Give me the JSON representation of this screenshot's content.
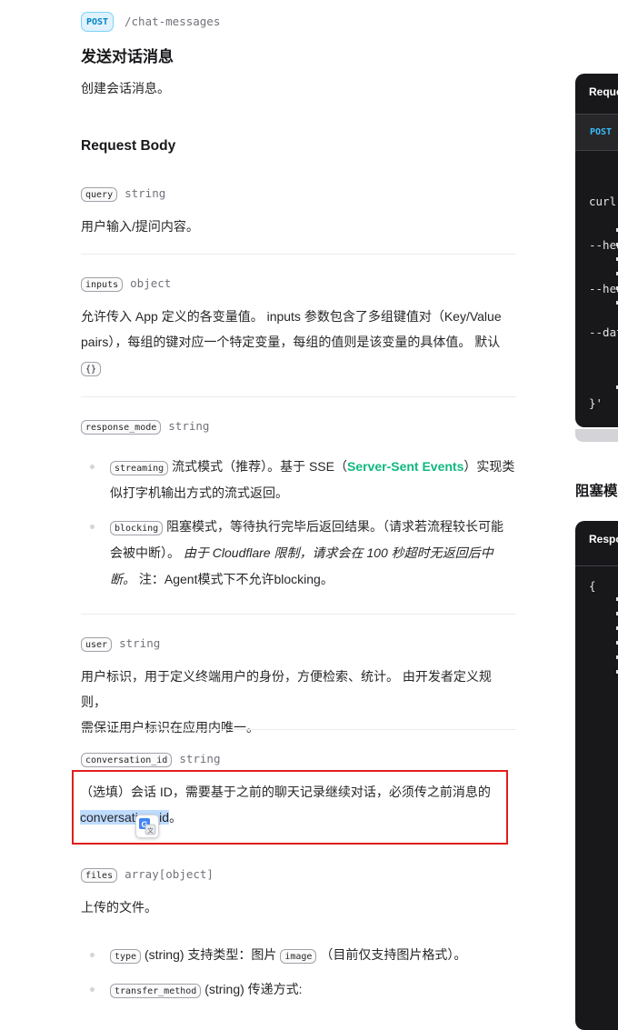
{
  "endpoint": {
    "method": "POST",
    "path": "/chat-messages",
    "title": "发送对话消息",
    "description": "创建会话消息。"
  },
  "request_body_heading": "Request Body",
  "params": {
    "query": {
      "name": "query",
      "type": "string",
      "desc": "用户输入/提问内容。"
    },
    "inputs": {
      "name": "inputs",
      "type": "object",
      "desc_line1": "允许传入 App 定义的各变量值。 inputs 参数包含了多组键值对（Key/Value",
      "desc_line2": "pairs），每组的键对应一个特定变量，每组的值则是该变量的具体值。 默认",
      "default_chip": "{}"
    },
    "response_mode": {
      "name": "response_mode",
      "type": "string",
      "streaming_chip": "streaming",
      "streaming_text_a": "流式模式（推荐）。基于 SSE（",
      "streaming_link": "Server-Sent Events",
      "streaming_text_b": "）实现类",
      "streaming_text_c": "似打字机输出方式的流式返回。",
      "blocking_chip": "blocking",
      "blocking_text_a": "阻塞模式，等待执行完毕后返回结果。（请求若流程较长可能",
      "blocking_text_b": "会被中断）。",
      "blocking_italic_a": "由于 Cloudflare 限制，请求会在 100 秒超时无返回后中",
      "blocking_italic_b": "断。",
      "blocking_text_c": " 注：Agent模式下不允许blocking。"
    },
    "user": {
      "name": "user",
      "type": "string",
      "desc_line1": "用户标识，用于定义终端用户的身份，方便检索、统计。 由开发者定义规则，",
      "desc_line2": "需保证用户标识在应用内唯一。"
    },
    "conversation_id": {
      "name": "conversation_id",
      "type": "string",
      "desc_line1": "（选填）会话 ID，需要基于之前的聊天记录继续对话，必须传之前消息的",
      "desc_selected": "conversation_id",
      "desc_end": "。"
    },
    "files": {
      "name": "files",
      "type": "array[object]",
      "desc": "上传的文件。",
      "type_chip": "type",
      "type_text_a": "(string) 支持类型：图片",
      "image_chip": "image",
      "type_text_b": "（目前仅支持图片格式）。",
      "transfer_chip": "transfer_method",
      "transfer_text": "(string) 传递方式:"
    }
  },
  "side": {
    "request_title": "Reque",
    "request_method": "POST",
    "code_lines": [
      "curl",
      "--hea",
      "--hea",
      "--dat"
    ],
    "code_end": "}'",
    "blocking_heading": "阻塞模",
    "response_title": "Respo",
    "response_open": "{"
  },
  "translate_icon": "google-translate-icon",
  "colors": {
    "post_badge_bg": "#e0f2fe",
    "post_badge_text": "#0284c7",
    "link": "#10b981",
    "highlight_border": "#e11d1d",
    "selection": "#bfdbfe",
    "code_bg": "#18181b"
  }
}
